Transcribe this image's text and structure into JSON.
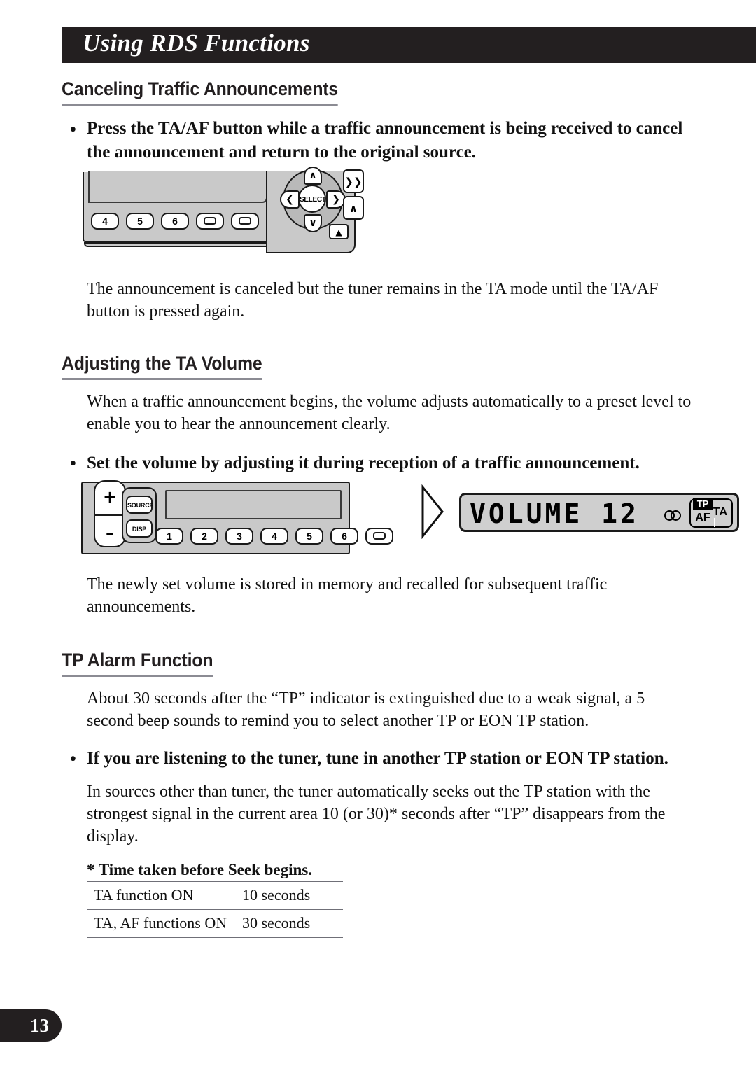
{
  "header": {
    "title": "Using RDS Functions"
  },
  "sections": [
    {
      "heading": "Canceling Traffic Announcements",
      "bullet": "Press the TA/AF button while a traffic announcement is being received to cancel the announcement and return to the original source.",
      "paragraph": "The announcement is canceled but the tuner remains in the TA mode until the TA/AF button is pressed again."
    },
    {
      "heading": "Adjusting the TA Volume",
      "paragraph_intro": "When a traffic announcement begins, the volume adjusts automatically to a preset level to enable you to hear the announcement clearly.",
      "bullet": "Set the volume by adjusting it during reception of a traffic announcement.",
      "paragraph_after": "The newly set volume is stored in memory and recalled for subsequent traffic announcements."
    },
    {
      "heading": "TP Alarm Function",
      "paragraph_intro": "About 30 seconds after the “TP” indicator is extinguished due to a weak signal, a 5 second beep sounds to remind you to select another TP or EON TP station.",
      "bullet": "If you are listening to the tuner, tune in another TP station or EON TP station.",
      "paragraph_after": "In sources other than tuner, the tuner automatically seeks out the TP station with the strongest signal in the current area 10 (or 30)* seconds after “TP” disappears from the display."
    }
  ],
  "bullet_marker": "•",
  "figure_head_unit": {
    "select_label": "SELECT",
    "arrow_left": "❮",
    "arrow_right": "❯",
    "arrow_up": "∧",
    "arrow_down": "∨",
    "side_button_top": "❯❯",
    "side_button_bottom": "∧",
    "eject_label": "▲",
    "presets": [
      "4",
      "5",
      "6",
      "",
      "",
      ""
    ]
  },
  "figure_volume_unit": {
    "plus_label": "+",
    "minus_label": "–",
    "source_label": "SOURCE",
    "disp_label": "DISP",
    "presets": [
      "1",
      "2",
      "3",
      "4",
      "5",
      "6",
      ""
    ]
  },
  "lcd_display": {
    "text": "VOLUME 12",
    "stereo_indicator": "stereo-icon",
    "tp_indicator": "TP",
    "af_indicator": "AF",
    "ta_indicator": "TA"
  },
  "footnote": "* Time taken before Seek begins.",
  "time_table": {
    "rows": [
      {
        "condition": "TA function ON",
        "time": "10 seconds"
      },
      {
        "condition": "TA, AF functions ON",
        "time": "30 seconds"
      }
    ]
  },
  "page_number": "13",
  "colors": {
    "header_bar": "#231f20",
    "rule": "#8b8b93",
    "device_body": "#c9c9c9"
  }
}
